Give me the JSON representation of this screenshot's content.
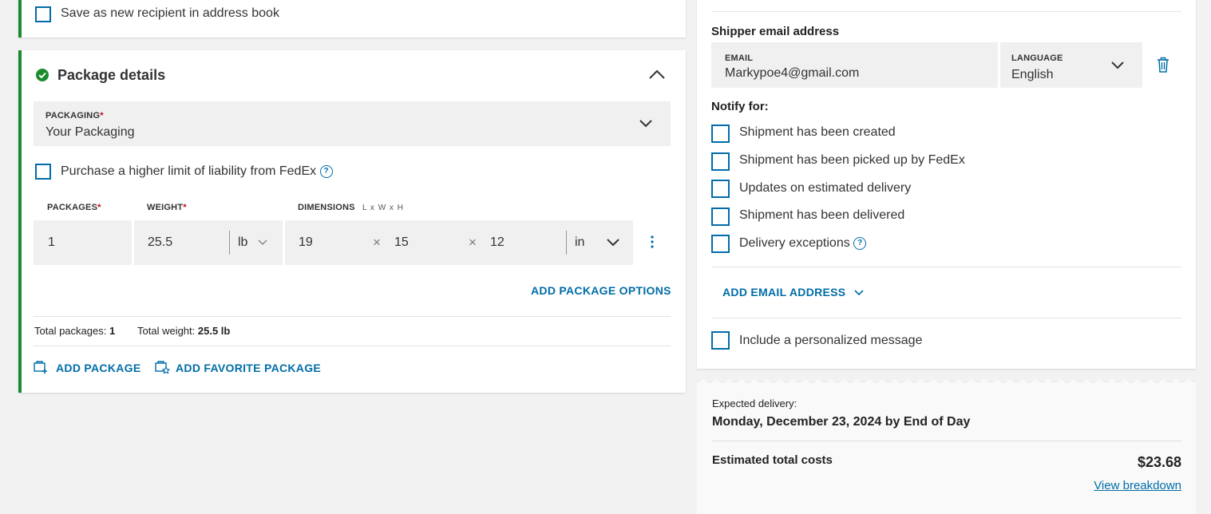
{
  "recipient": {
    "save_label": "Save as new recipient in address book"
  },
  "package": {
    "title": "Package details",
    "packaging_label": "PACKAGING",
    "packaging_value": "Your Packaging",
    "liability_label": "Purchase a higher limit of liability from FedEx",
    "packages_label": "PACKAGES",
    "weight_label": "WEIGHT",
    "dimensions_label": "DIMENSIONS",
    "dimensions_hint": "L x W x H",
    "packages_value": "1",
    "weight_value": "25.5",
    "weight_unit": "lb",
    "dim_l": "19",
    "dim_w": "15",
    "dim_h": "12",
    "dim_unit": "in",
    "times": "×",
    "add_options": "ADD PACKAGE OPTIONS",
    "total_packages_label": "Total packages:",
    "total_packages_value": "1",
    "total_weight_label": "Total weight:",
    "total_weight_value": "25.5 lb",
    "add_package": "ADD PACKAGE",
    "add_favorite": "ADD FAVORITE PACKAGE",
    "required_mark": "*"
  },
  "notify": {
    "shipper_email_title": "Shipper email address",
    "email_label": "EMAIL",
    "email_value": "Markypoe4@gmail.com",
    "language_label": "LANGUAGE",
    "language_value": "English",
    "notify_for": "Notify for:",
    "options": [
      "Shipment has been created",
      "Shipment has been picked up by FedEx",
      "Updates on estimated delivery",
      "Shipment has been delivered",
      "Delivery exceptions"
    ],
    "add_email": "ADD EMAIL ADDRESS",
    "personal_message": "Include a personalized message"
  },
  "summary": {
    "expected_label": "Expected delivery:",
    "expected_value": "Monday, December 23, 2024 by End of Day",
    "total_label": "Estimated total costs",
    "total_value": "$23.68",
    "breakdown": "View breakdown"
  },
  "colors": {
    "accent": "#006da8",
    "success": "#1b8c2e",
    "required": "#c4001a"
  }
}
